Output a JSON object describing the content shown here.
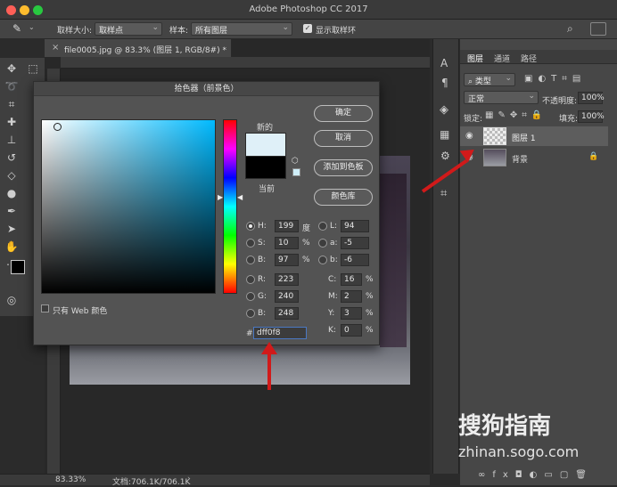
{
  "app": {
    "title": "Adobe Photoshop CC 2017"
  },
  "options_bar": {
    "sample_size_label": "取样大小:",
    "sample_size_value": "取样点",
    "sample_label": "样本:",
    "sample_value": "所有图层",
    "show_ring_label": "显示取样环"
  },
  "doc_tab": {
    "title": "file0005.jpg @ 83.3% (图层 1, RGB/8#) *",
    "close": "×"
  },
  "status": {
    "zoom": "83.33%",
    "doc_info": "文档:706.1K/706.1K"
  },
  "dialog": {
    "title": "拾色器（前景色）",
    "new_label": "新的",
    "current_label": "当前",
    "buttons": {
      "ok": "确定",
      "cancel": "取消",
      "add_swatch": "添加到色板",
      "libraries": "颜色库"
    },
    "web_only": "只有 Web 颜色",
    "hsb": [
      {
        "label": "H:",
        "value": "199",
        "unit": "度"
      },
      {
        "label": "S:",
        "value": "10",
        "unit": "%"
      },
      {
        "label": "B:",
        "value": "97",
        "unit": "%"
      }
    ],
    "rgb": [
      {
        "label": "R:",
        "value": "223"
      },
      {
        "label": "G:",
        "value": "240"
      },
      {
        "label": "B:",
        "value": "248"
      }
    ],
    "lab": [
      {
        "label": "L:",
        "value": "94"
      },
      {
        "label": "a:",
        "value": "-5"
      },
      {
        "label": "b:",
        "value": "-6"
      }
    ],
    "cmyk": [
      {
        "label": "C:",
        "value": "16",
        "unit": "%"
      },
      {
        "label": "M:",
        "value": "2",
        "unit": "%"
      },
      {
        "label": "Y:",
        "value": "3",
        "unit": "%"
      },
      {
        "label": "K:",
        "value": "0",
        "unit": "%"
      }
    ],
    "hex_label": "#",
    "hex_value": "dff0f8",
    "new_color": "#dff0f8",
    "current_color": "#000000"
  },
  "layers_panel": {
    "tabs": [
      "图层",
      "通道",
      "路径"
    ],
    "filter_kind": "类型",
    "blend_mode": "正常",
    "opacity_label": "不透明度:",
    "opacity_value": "100%",
    "lock_label": "锁定:",
    "fill_label": "填充:",
    "fill_value": "100%",
    "layers": [
      {
        "name": "图层 1"
      },
      {
        "name": "背景"
      }
    ]
  },
  "watermark": {
    "line1": "搜狗指南",
    "line2": "zhinan.sogo.com"
  },
  "colors": {
    "accent_arrow": "#d11a1a",
    "field_hue": "#00baff"
  }
}
